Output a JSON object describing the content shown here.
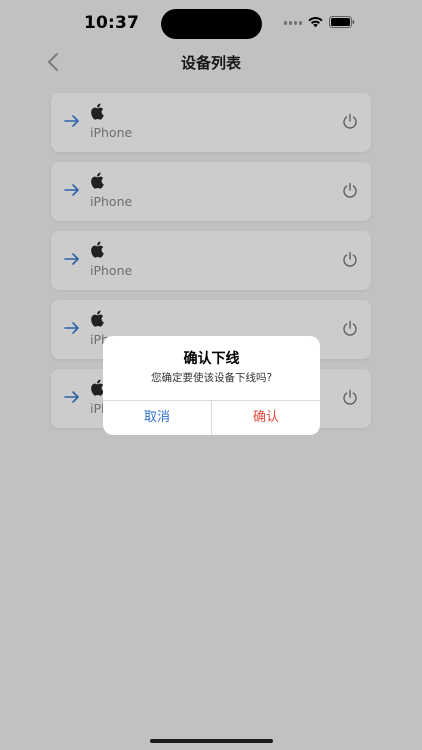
{
  "status_bar": {
    "time": "10:37"
  },
  "nav": {
    "title": "设备列表",
    "back_icon": "chevron-left-icon"
  },
  "devices": [
    {
      "name": "iPhone",
      "icon": "apple-icon"
    },
    {
      "name": "iPhone",
      "icon": "apple-icon"
    },
    {
      "name": "iPhone",
      "icon": "apple-icon"
    },
    {
      "name": "iPhone",
      "icon": "apple-icon"
    },
    {
      "name": "iPhone",
      "icon": "apple-icon"
    }
  ],
  "dialog": {
    "title": "确认下线",
    "message": "您确定要使该设备下线吗?",
    "cancel_label": "取消",
    "confirm_label": "确认"
  },
  "colors": {
    "accent_blue": "#2f6fd0",
    "danger_red": "#e04b3f",
    "background": "#f2f2f2"
  }
}
